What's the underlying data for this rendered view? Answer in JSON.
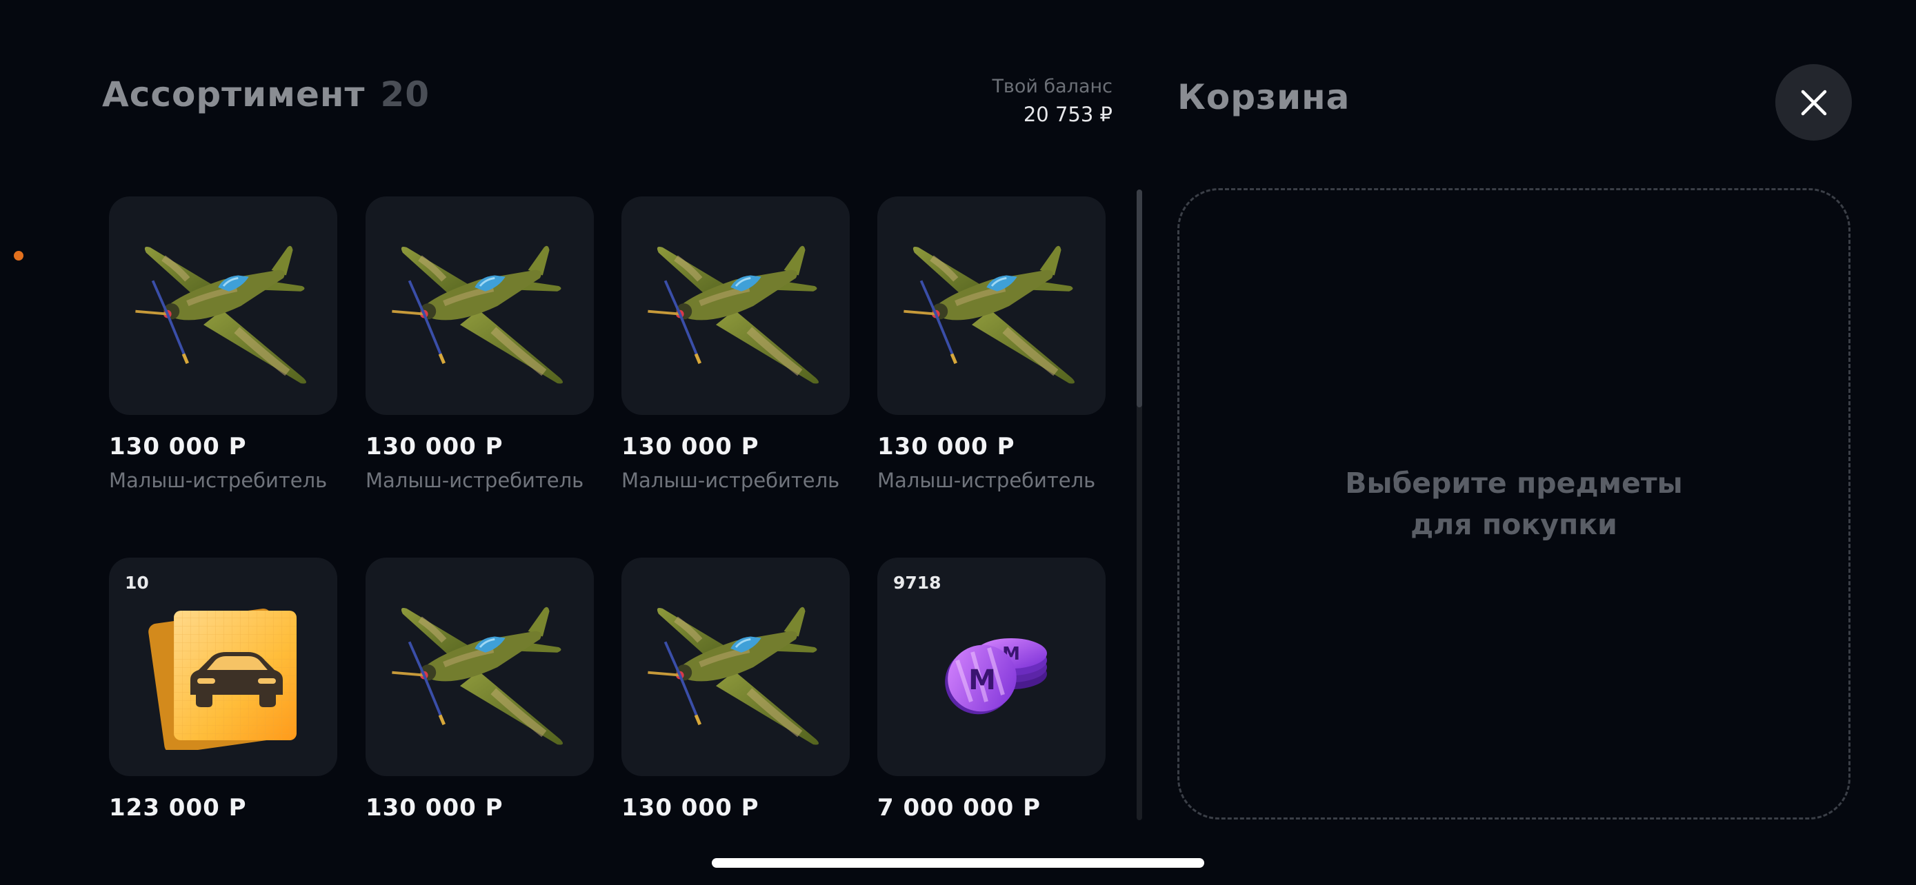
{
  "assortment": {
    "title": "Ассортимент",
    "count": "20"
  },
  "balance": {
    "label": "Твой баланс",
    "value": "20 753 ₽"
  },
  "cart": {
    "title": "Корзина",
    "empty_line1": "Выберите предметы",
    "empty_line2": "для покупки"
  },
  "items": [
    {
      "price": "130 000 Р",
      "name": "Малыш-истребитель",
      "icon": "fighter-plane-icon"
    },
    {
      "price": "130 000 Р",
      "name": "Малыш-истребитель",
      "icon": "fighter-plane-icon"
    },
    {
      "price": "130 000 Р",
      "name": "Малыш-истребитель",
      "icon": "fighter-plane-icon"
    },
    {
      "price": "130 000 Р",
      "name": "Малыш-истребитель",
      "icon": "fighter-plane-icon"
    },
    {
      "price": "123 000 Р",
      "badge": "10",
      "icon": "car-card-icon"
    },
    {
      "price": "130 000 Р",
      "icon": "fighter-plane-icon"
    },
    {
      "price": "130 000 Р",
      "icon": "fighter-plane-icon"
    },
    {
      "price": "7 000 000 Р",
      "badge": "9718",
      "icon": "coins-icon"
    }
  ],
  "colors": {
    "background": "#05080f",
    "tile": "#141820",
    "accent_dot": "#e2701e"
  }
}
